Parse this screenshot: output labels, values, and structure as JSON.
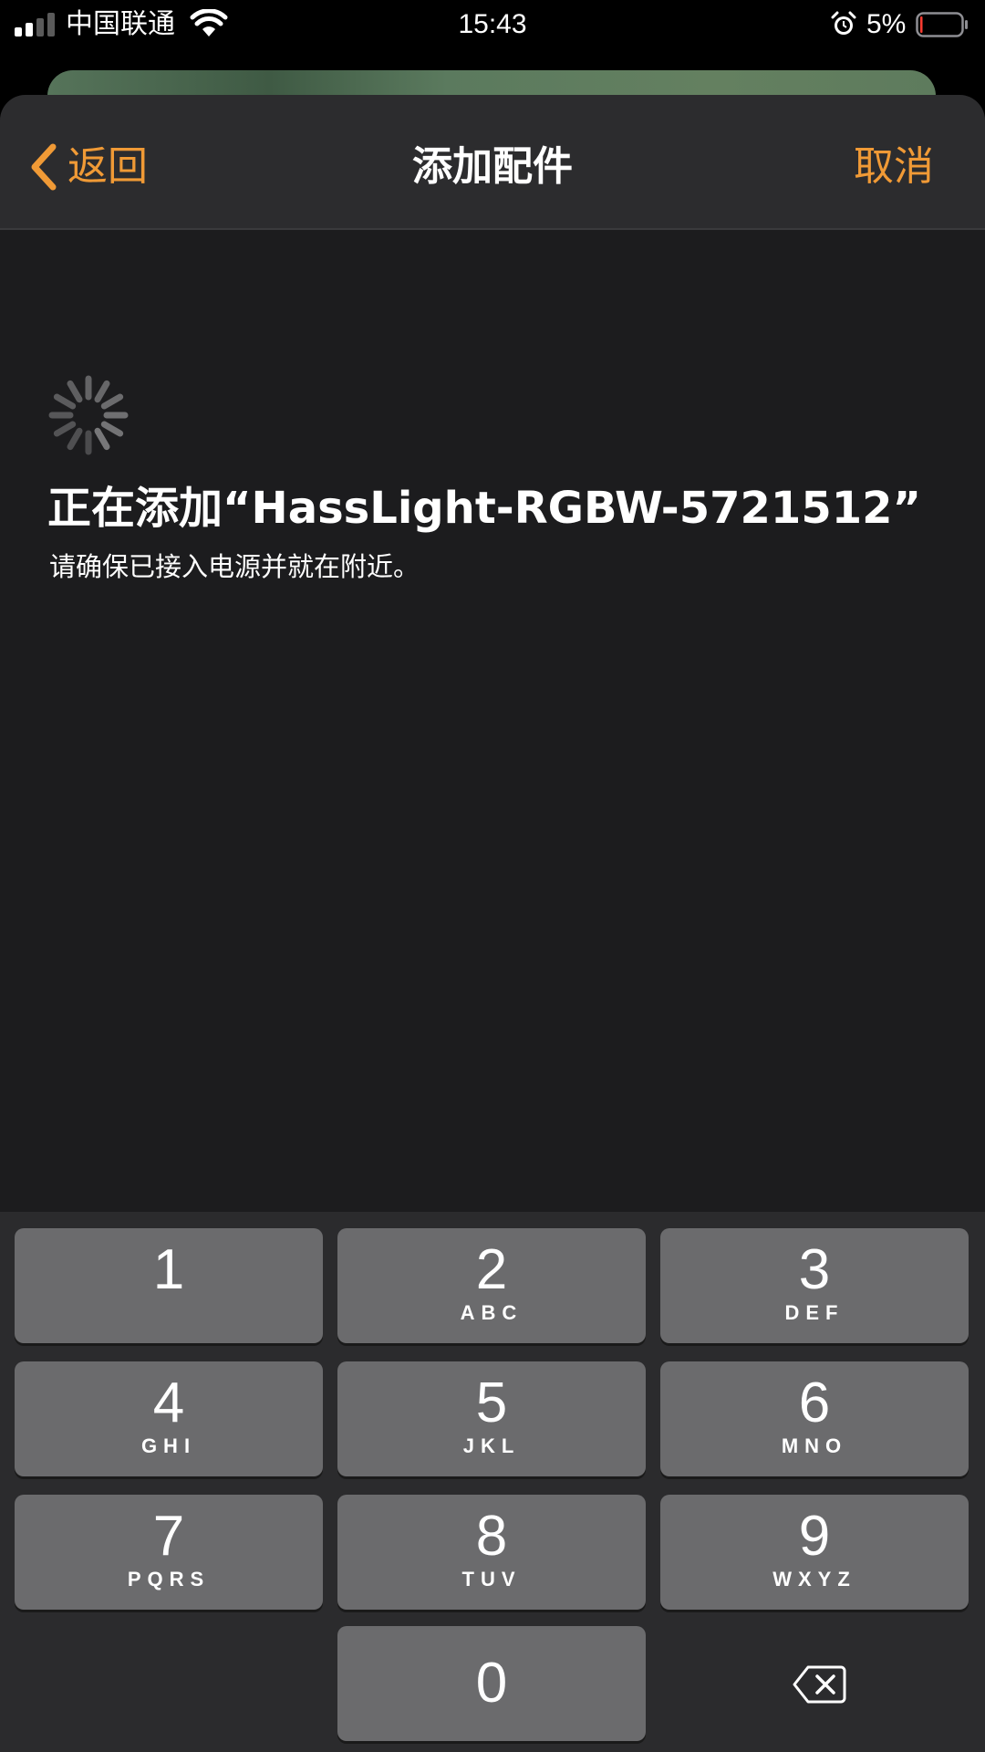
{
  "status_bar": {
    "carrier": "中国联通",
    "time": "15:43",
    "battery_percent": "5%",
    "signal_bars_active": 2,
    "battery_level": 0.05,
    "icons": [
      "signal-icon",
      "wifi-icon",
      "alarm-icon",
      "battery-icon"
    ]
  },
  "nav": {
    "back_label": "返回",
    "title": "添加配件",
    "cancel_label": "取消",
    "accent_color": "#f09a36"
  },
  "main": {
    "title": "正在添加“HassLight-RGBW-5721512”",
    "subtitle": "请确保已接入电源并就在附近。",
    "spinner_icon": "activity-spinner-icon"
  },
  "keypad": {
    "keys": [
      {
        "digit": "1",
        "letters": ""
      },
      {
        "digit": "2",
        "letters": "ABC"
      },
      {
        "digit": "3",
        "letters": "DEF"
      },
      {
        "digit": "4",
        "letters": "GHI"
      },
      {
        "digit": "5",
        "letters": "JKL"
      },
      {
        "digit": "6",
        "letters": "MNO"
      },
      {
        "digit": "7",
        "letters": "PQRS"
      },
      {
        "digit": "8",
        "letters": "TUV"
      },
      {
        "digit": "9",
        "letters": "WXYZ"
      },
      {
        "digit": "0",
        "letters": ""
      }
    ],
    "delete_icon": "backspace-icon"
  }
}
